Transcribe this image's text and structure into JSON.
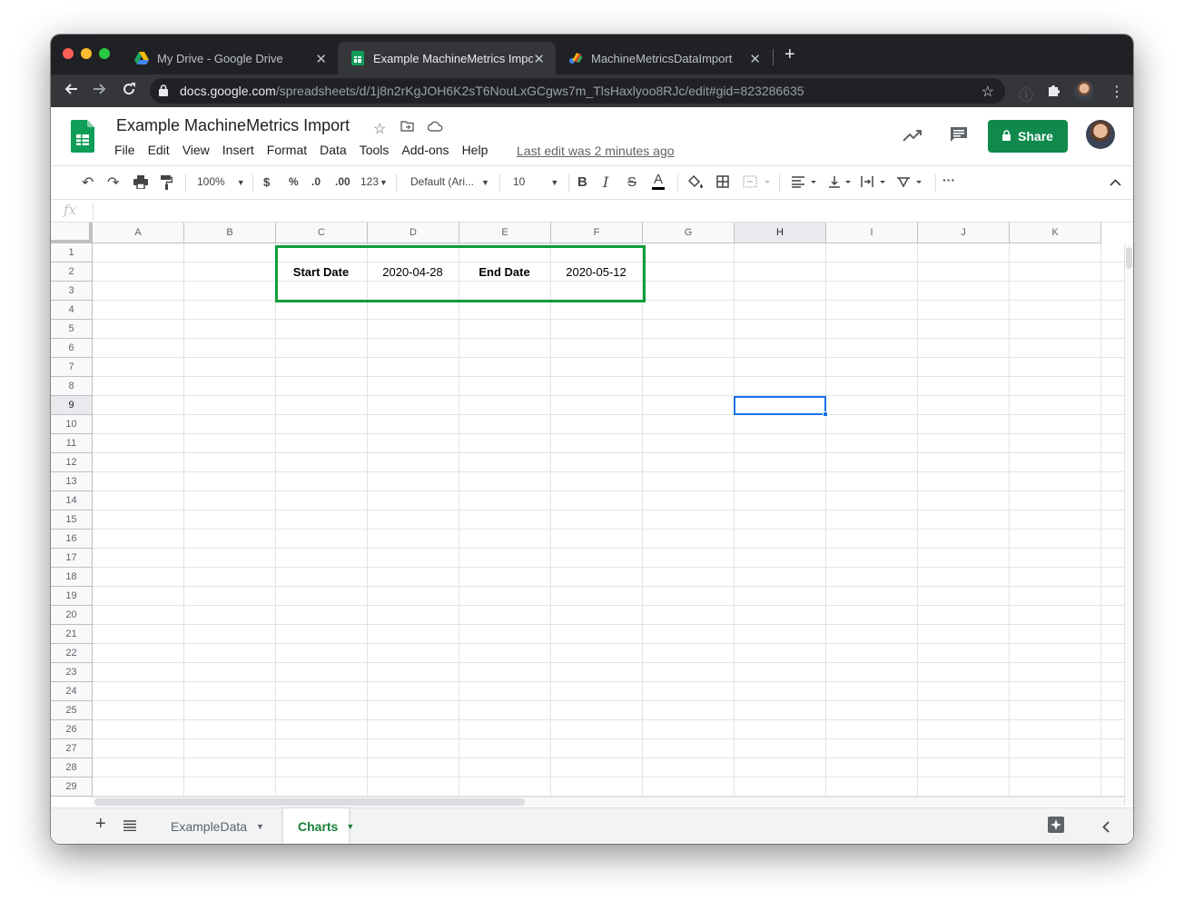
{
  "browser": {
    "tabs": [
      {
        "title": "My Drive - Google Drive",
        "icon": "google-drive-icon"
      },
      {
        "title": "Example MachineMetrics Impor",
        "icon": "google-sheets-icon",
        "active": true
      },
      {
        "title": "MachineMetricsDataImport",
        "icon": "apps-script-icon"
      }
    ],
    "url_host": "docs.google.com",
    "url_path": "/spreadsheets/d/1j8n2rKgJOH6K2sT6NouLxGCgws7m_TlsHaxlyoo8RJc/edit#gid=823286635"
  },
  "doc": {
    "title": "Example MachineMetrics Import",
    "menu": [
      "File",
      "Edit",
      "View",
      "Insert",
      "Format",
      "Data",
      "Tools",
      "Add-ons",
      "Help"
    ],
    "last_edit": "Last edit was 2 minutes ago",
    "share_label": "Share"
  },
  "toolbar": {
    "zoom": "100%",
    "currency": "$",
    "percent": "%",
    "dec_decrease": ".0",
    "dec_increase": ".00",
    "number_format": "123",
    "font": "Default (Ari...",
    "font_size": "10",
    "bold": "B",
    "italic": "I",
    "strike": "S",
    "text_color": "A",
    "more": "···"
  },
  "grid": {
    "columns": [
      "A",
      "B",
      "C",
      "D",
      "E",
      "F",
      "G",
      "H",
      "I",
      "J",
      "K"
    ],
    "rows": [
      "1",
      "2",
      "3",
      "4",
      "5",
      "6",
      "7",
      "8",
      "9",
      "10",
      "11",
      "12",
      "13",
      "14",
      "15",
      "16",
      "17",
      "18",
      "19",
      "20",
      "21",
      "22",
      "23",
      "24",
      "25",
      "26",
      "27",
      "28",
      "29"
    ],
    "selected_column": "H",
    "selected_row": "9",
    "cells": {
      "C2": "Start Date",
      "D2": "2020-04-28",
      "E2": "End Date",
      "F2": "2020-05-12"
    }
  },
  "sheets": [
    {
      "name": "ExampleData",
      "active": false
    },
    {
      "name": "Charts",
      "active": true
    }
  ],
  "colors": {
    "sheets_green": "#0f9d58",
    "share_green": "#0f8a4c",
    "highlight_box": "#0d9d3a",
    "selection_blue": "#1a73e8"
  }
}
